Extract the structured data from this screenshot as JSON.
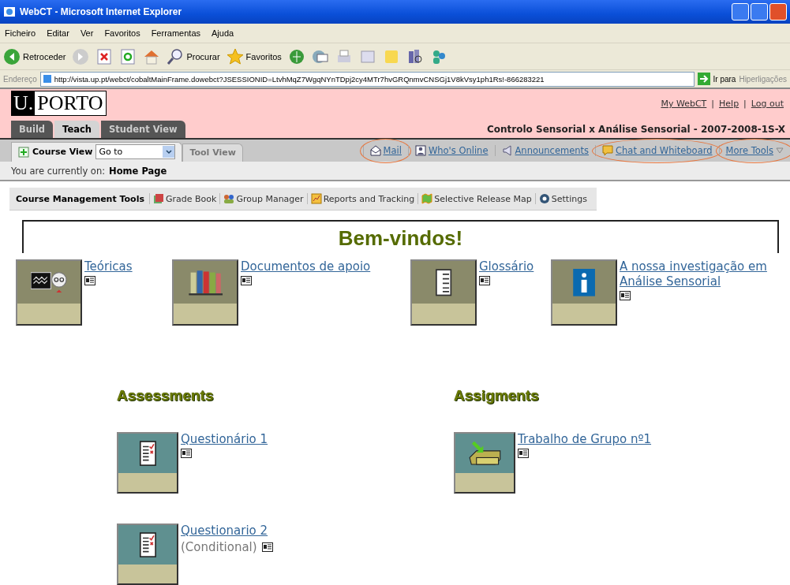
{
  "window": {
    "title": "WebCT - Microsoft Internet Explorer"
  },
  "menu": [
    "Ficheiro",
    "Editar",
    "Ver",
    "Favoritos",
    "Ferramentas",
    "Ajuda"
  ],
  "toolbar": [
    {
      "kind": "back",
      "label": "Retroceder"
    },
    {
      "kind": "forward"
    },
    {
      "kind": "stop"
    },
    {
      "kind": "refresh"
    },
    {
      "kind": "home"
    },
    {
      "kind": "search",
      "label": "Procurar"
    },
    {
      "kind": "favorites",
      "label": "Favoritos"
    },
    {
      "kind": "media"
    },
    {
      "kind": "mail"
    },
    {
      "kind": "print"
    },
    {
      "kind": "edit"
    },
    {
      "kind": "note"
    },
    {
      "kind": "research"
    },
    {
      "kind": "messenger"
    }
  ],
  "address": {
    "label": "Endereço",
    "url": "http://vista.up.pt/webct/cobaltMainFrame.dowebct?JSESSIONID=LtvhMqZ7WgqNYnTDpj2cy4MTr7hvGRQnmvCNSGj1V8kVsy1ph1Rs!-866283221",
    "go": "Ir para",
    "links": "Hiperligações"
  },
  "header": {
    "logo_left": "U.",
    "logo_right": "PORTO",
    "links": [
      "My WebCT",
      "Help",
      "Log out"
    ],
    "separator": "|",
    "course_title": "Controlo Sensorial x Análise Sensorial - 2007-2008-1S-X"
  },
  "role_tabs": [
    {
      "label": "Build",
      "selected": false
    },
    {
      "label": "Teach",
      "selected": true
    },
    {
      "label": "Student View",
      "selected": false
    }
  ],
  "view_tabs": [
    {
      "label": "Course View",
      "selected": true
    },
    {
      "label": "Tool View",
      "selected": false
    }
  ],
  "goto": {
    "value": "Go to"
  },
  "tool_links": [
    {
      "kind": "mail",
      "label": "Mail",
      "highlighted": true
    },
    {
      "kind": "online",
      "label": "Who's Online",
      "highlighted": false
    },
    {
      "kind": "announce",
      "label": "Announcements",
      "highlighted": false
    },
    {
      "kind": "chat",
      "label": "Chat and Whiteboard",
      "highlighted": true
    },
    {
      "kind": "more",
      "label": "More Tools",
      "highlighted": true
    }
  ],
  "breadcrumb": {
    "label": "You are currently on:",
    "page": "Home Page"
  },
  "management": {
    "label": "Course Management Tools",
    "tools": [
      {
        "kind": "grade",
        "label": "Grade Book"
      },
      {
        "kind": "group",
        "label": "Group Manager"
      },
      {
        "kind": "reports",
        "label": "Reports and Tracking"
      },
      {
        "kind": "release",
        "label": "Selective Release Map"
      },
      {
        "kind": "settings",
        "label": "Settings"
      }
    ]
  },
  "welcome": "Bem-vindos!",
  "items": [
    {
      "kind": "lectures",
      "title": "Teóricas"
    },
    {
      "kind": "books",
      "title": "Documentos de apoio"
    },
    {
      "kind": "glossary",
      "title": "Glossário"
    },
    {
      "kind": "info",
      "title": "A nossa investigação em Análise Sensorial"
    }
  ],
  "sections": [
    {
      "heading": "Assessments",
      "items": [
        {
          "kind": "quiz",
          "title": "Questionário 1"
        },
        {
          "kind": "quiz",
          "title": "Questionario 2",
          "note": "(Conditional)"
        }
      ]
    },
    {
      "heading": "Assigments",
      "items": [
        {
          "kind": "dropbox",
          "title": "Trabalho de Grupo nº1"
        }
      ]
    }
  ]
}
